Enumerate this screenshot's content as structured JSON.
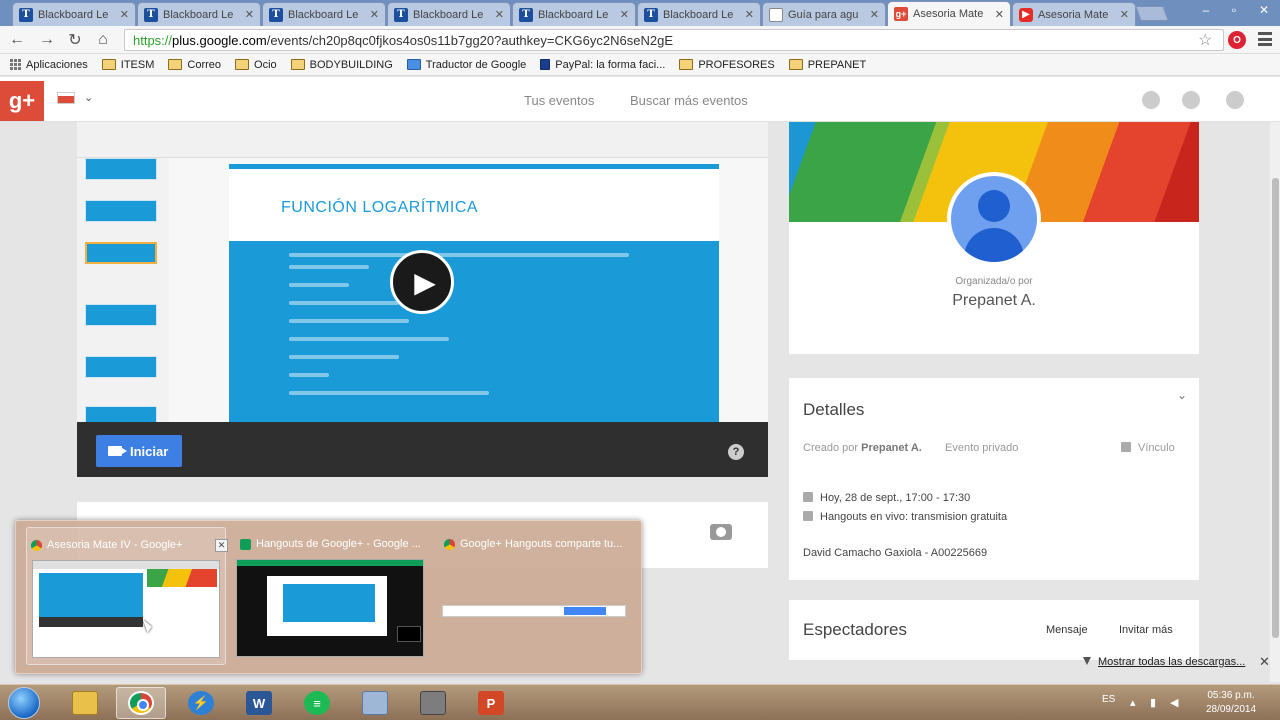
{
  "browser": {
    "tabs": [
      {
        "label": "Blackboard Le",
        "icon": "blackboard-icon",
        "active": false
      },
      {
        "label": "Blackboard Le",
        "icon": "blackboard-icon",
        "active": false
      },
      {
        "label": "Blackboard Le",
        "icon": "blackboard-icon",
        "active": false
      },
      {
        "label": "Blackboard Le",
        "icon": "blackboard-icon",
        "active": false
      },
      {
        "label": "Blackboard Le",
        "icon": "blackboard-icon",
        "active": false
      },
      {
        "label": "Blackboard Le",
        "icon": "blackboard-icon",
        "active": false
      },
      {
        "label": "Guía para agu",
        "icon": "document-icon",
        "active": false
      },
      {
        "label": "Asesoria Mate",
        "icon": "gplus-icon",
        "active": true
      },
      {
        "label": "Asesoria Mate",
        "icon": "youtube-icon",
        "active": false
      }
    ],
    "url_scheme": "https://",
    "url_domain": "plus.google.com",
    "url_path": "/events/ch20p8qc0fjkos4os0s11b7gg20?authkey=CKG6yc2N6seN2gE",
    "bookmarks": [
      {
        "label": "Aplicaciones",
        "icon": "apps-icon"
      },
      {
        "label": "ITESM",
        "icon": "folder-icon"
      },
      {
        "label": "Correo",
        "icon": "folder-icon"
      },
      {
        "label": "Ocio",
        "icon": "folder-icon"
      },
      {
        "label": "BODYBUILDING",
        "icon": "folder-icon"
      },
      {
        "label": "Traductor de Google",
        "icon": "translate-icon"
      },
      {
        "label": "PayPal: la forma faci...",
        "icon": "paypal-icon"
      },
      {
        "label": "PROFESORES",
        "icon": "folder-icon"
      },
      {
        "label": "PREPANET",
        "icon": "folder-icon"
      }
    ]
  },
  "gplus": {
    "logo": "g+",
    "nav_my_events": "Tus eventos",
    "nav_search_events": "Buscar más eventos"
  },
  "video": {
    "slide_title": "FUNCIÓN LOGARÍTMICA",
    "start_button": "Iniciar",
    "help": "?"
  },
  "event": {
    "organized_by_label": "Organizada/o por",
    "organizer": "Prepanet A.",
    "details_title": "Detalles",
    "created_by_label": "Creado por",
    "created_by": "Prepanet A.",
    "privacy": "Evento privado",
    "link_label": "Vínculo",
    "date_time": "Hoy, 28 de sept., 17:00 - 17:30",
    "location": "Hangouts en vivo: transmision gratuita",
    "description": "David Camacho Gaxiola - A00225669",
    "viewers_title": "Espectadores",
    "message_button": "Mensaje",
    "invite_button": "Invitar más"
  },
  "taskbar_preview": [
    {
      "title": "Asesoria Mate IV - Google+",
      "icon": "chrome-icon"
    },
    {
      "title": "Hangouts de Google+ - Google ...",
      "icon": "hangouts-icon"
    },
    {
      "title": "Google+ Hangouts comparte tu...",
      "icon": "chrome-icon"
    }
  ],
  "downloads": {
    "show_all": "Mostrar todas las descargas..."
  },
  "os_taskbar": {
    "language": "ES",
    "time": "05:36 p.m.",
    "date": "28/09/2014"
  },
  "colors": {
    "gplus_red": "#dd4b39",
    "accent_blue": "#3d7fe3",
    "slide_blue": "#1b9ad8"
  }
}
